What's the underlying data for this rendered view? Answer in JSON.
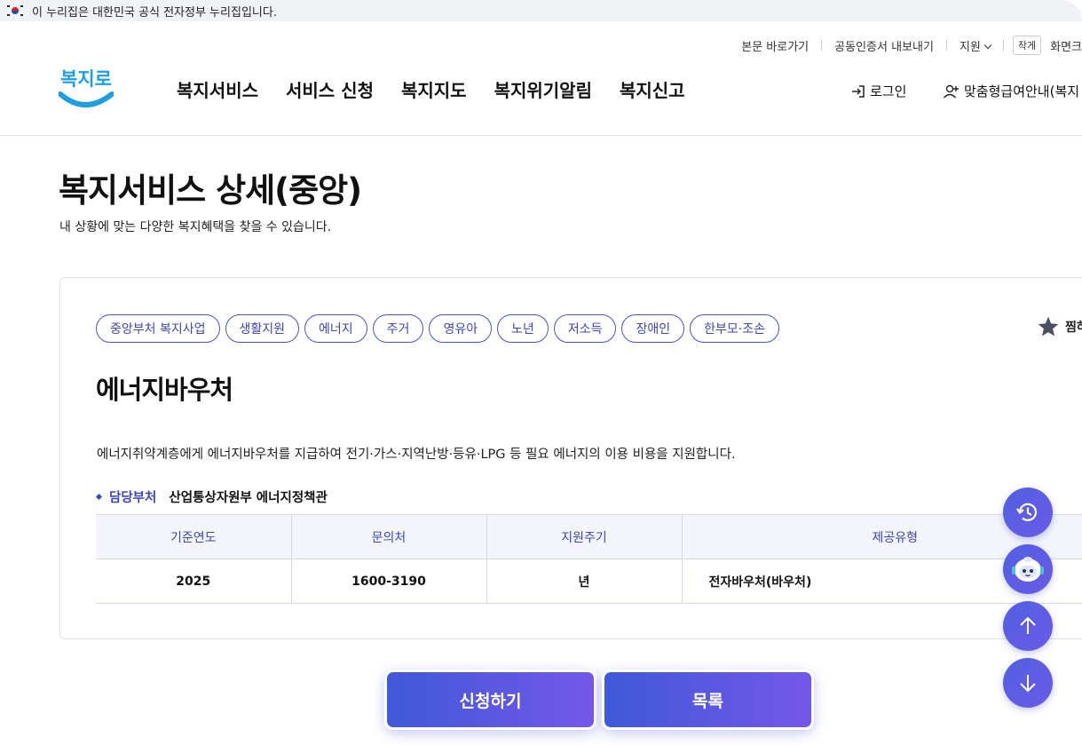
{
  "gov_banner": {
    "text": "이 누리집은 대한민국 공식 전자정부 누리집입니다."
  },
  "utility": {
    "skip": "본문 바로가기",
    "cert": "공동인증서 내보내기",
    "support": "지원",
    "size_btn": "작게",
    "screen": "화면크"
  },
  "logo": {
    "text": "복지로"
  },
  "nav": {
    "items": [
      "복지서비스",
      "서비스 신청",
      "복지지도",
      "복지위기알림",
      "복지신고"
    ]
  },
  "header_right": {
    "login": "로그인",
    "guide": "맞춤형급여안내(복지"
  },
  "page": {
    "title": "복지서비스 상세(중앙)",
    "description": "내 상황에 맞는 다양한 복지혜택을 찾을 수 있습니다."
  },
  "service": {
    "tags": [
      "중앙부처 복지사업",
      "생활지원",
      "에너지",
      "주거",
      "영유아",
      "노년",
      "저소득",
      "장애인",
      "한부모·조손"
    ],
    "favorite": "찜하",
    "name": "에너지바우처",
    "description": "에너지취약계층에게 에너지바우처를 지급하여 전기·가스·지역난방·등유·LPG 등 필요 에너지의 이용 비용을 지원합니다.",
    "dept_label": "담당부처",
    "dept_value": "산업통상자원부 에너지정책관",
    "table": {
      "headers": [
        "기준연도",
        "문의처",
        "지원주기",
        "제공유형"
      ],
      "row": [
        "2025",
        "1600-3190",
        "년",
        "전자바우처(바우처)"
      ]
    }
  },
  "buttons": {
    "apply": "신청하기",
    "list": "목록"
  },
  "colors": {
    "accent": "#3d47b5",
    "button_gradient_start": "#3f59d8",
    "button_gradient_end": "#7558e8",
    "table_header_bg": "#f3f5fb"
  },
  "icons": {
    "history": "history-icon",
    "chatbot": "chatbot-icon",
    "up": "arrow-up-icon",
    "down": "arrow-down-icon",
    "star": "star-icon",
    "login": "login-icon",
    "user_add": "user-plus-icon"
  }
}
